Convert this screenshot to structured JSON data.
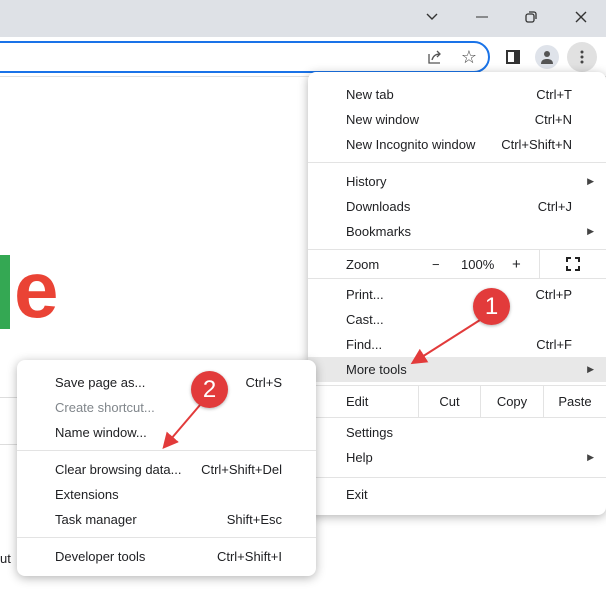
{
  "window": {
    "icons": [
      "chevron-down-icon",
      "minimize-icon",
      "restore-icon",
      "close-icon"
    ]
  },
  "toolbar": {
    "icons": [
      "share-icon",
      "star-icon",
      "side-panel-icon",
      "profile-icon",
      "more-icon"
    ]
  },
  "page": {
    "partial_text": "ut"
  },
  "main_menu": {
    "new_tab": {
      "label": "New tab",
      "shortcut": "Ctrl+T"
    },
    "new_window": {
      "label": "New window",
      "shortcut": "Ctrl+N"
    },
    "incognito": {
      "label": "New Incognito window",
      "shortcut": "Ctrl+Shift+N"
    },
    "history": {
      "label": "History"
    },
    "downloads": {
      "label": "Downloads",
      "shortcut": "Ctrl+J"
    },
    "bookmarks": {
      "label": "Bookmarks"
    },
    "zoom": {
      "label": "Zoom",
      "minus": "−",
      "value": "100%",
      "plus": "+"
    },
    "print": {
      "label": "Print...",
      "shortcut": "Ctrl+P"
    },
    "cast": {
      "label": "Cast..."
    },
    "find": {
      "label": "Find...",
      "shortcut": "Ctrl+F"
    },
    "more_tools": {
      "label": "More tools"
    },
    "edit": {
      "label": "Edit",
      "cut": "Cut",
      "copy": "Copy",
      "paste": "Paste"
    },
    "settings": {
      "label": "Settings"
    },
    "help": {
      "label": "Help"
    },
    "exit": {
      "label": "Exit"
    }
  },
  "sub_menu": {
    "save_page": {
      "label": "Save page as...",
      "shortcut": "Ctrl+S"
    },
    "create_shortcut": {
      "label": "Create shortcut..."
    },
    "name_window": {
      "label": "Name window..."
    },
    "clear_data": {
      "label": "Clear browsing data...",
      "shortcut": "Ctrl+Shift+Del"
    },
    "extensions": {
      "label": "Extensions"
    },
    "task_manager": {
      "label": "Task manager",
      "shortcut": "Shift+Esc"
    },
    "dev_tools": {
      "label": "Developer tools",
      "shortcut": "Ctrl+Shift+I"
    }
  },
  "annotations": {
    "step1": "1",
    "step2": "2",
    "color": "#e23b3b"
  }
}
